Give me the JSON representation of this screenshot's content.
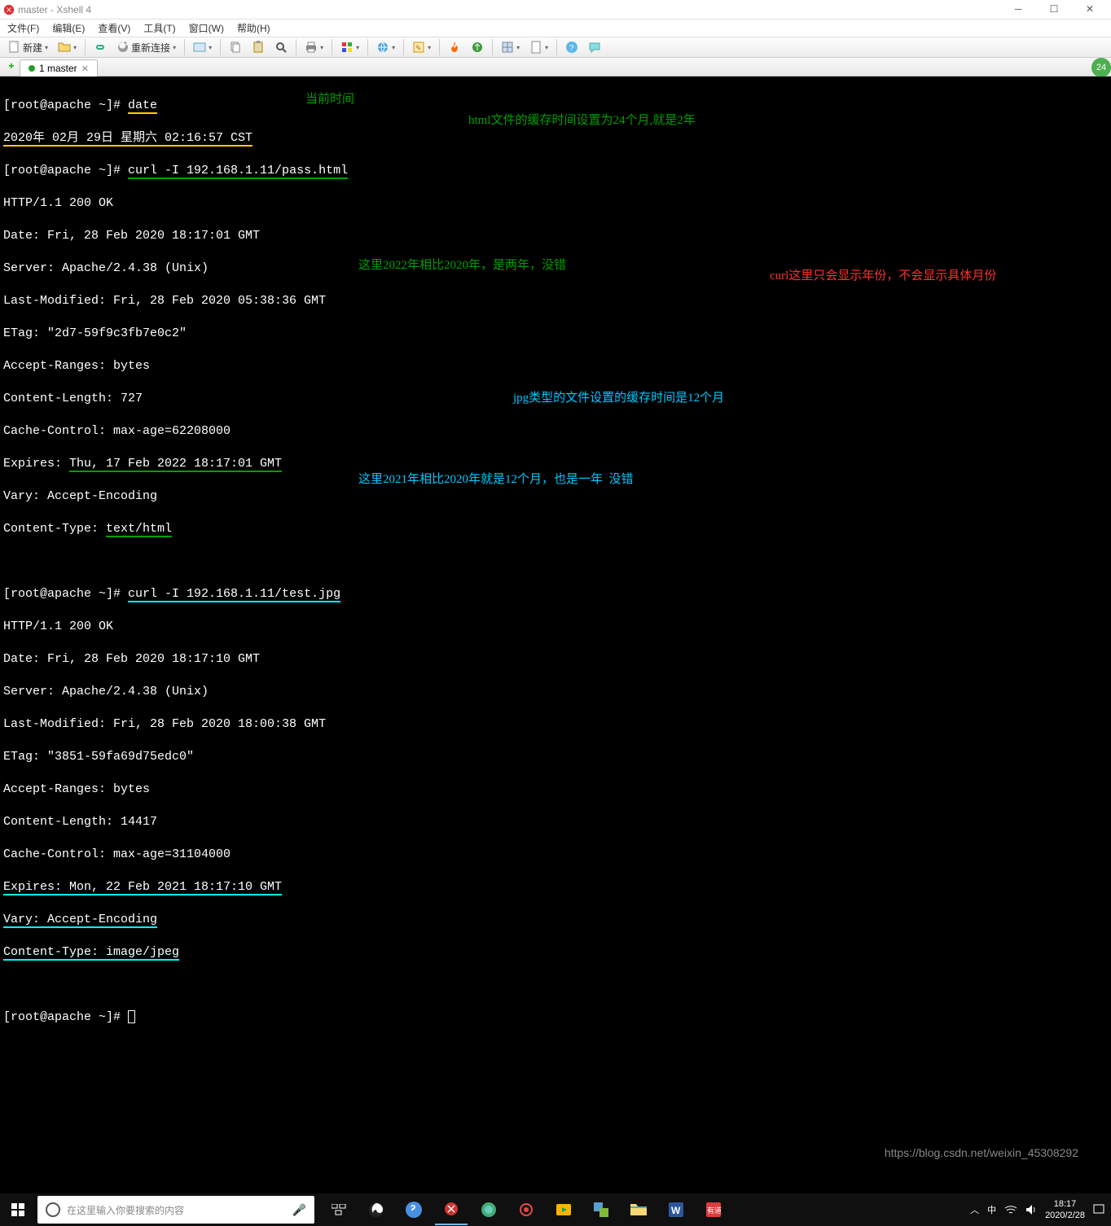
{
  "window": {
    "title": "master - Xshell 4"
  },
  "menus": {
    "file": "文件(F)",
    "edit": "编辑(E)",
    "view": "查看(V)",
    "tools": "工具(T)",
    "window": "窗口(W)",
    "help": "帮助(H)"
  },
  "toolbar": {
    "newBtn": "新建",
    "reconnect": " 重新连接"
  },
  "tab": {
    "label": "1 master",
    "badge": "24"
  },
  "term": {
    "prompt": "[root@apache ~]# ",
    "cmd1": "date",
    "dateOut": "2020年 02月 29日 星期六 02:16:57 CST",
    "cmd2": "curl -I 192.168.1.11/pass.html",
    "r1l1": "HTTP/1.1 200 OK",
    "r1l2": "Date: Fri, 28 Feb 2020 18:17:01 GMT",
    "r1l3": "Server: Apache/2.4.38 (Unix)",
    "r1l4": "Last-Modified: Fri, 28 Feb 2020 05:38:36 GMT",
    "r1l5": "ETag: \"2d7-59f9c3fb7e0c2\"",
    "r1l6": "Accept-Ranges: bytes",
    "r1l7": "Content-Length: 727",
    "r1l8": "Cache-Control: max-age=62208000",
    "r1l9a": "Expires: ",
    "r1l9b": "Thu, 17 Feb 2022 18:17:01 GMT",
    "r1l10": "Vary: Accept-Encoding",
    "r1l11a": "Content-Type: ",
    "r1l11b": "text/html",
    "cmd3": "curl -I 192.168.1.11/test.jpg",
    "r2l1": "HTTP/1.1 200 OK",
    "r2l2": "Date: Fri, 28 Feb 2020 18:17:10 GMT",
    "r2l3": "Server: Apache/2.4.38 (Unix)",
    "r2l4": "Last-Modified: Fri, 28 Feb 2020 18:00:38 GMT",
    "r2l5": "ETag: \"3851-59fa69d75edc0\"",
    "r2l6": "Accept-Ranges: bytes",
    "r2l7": "Content-Length: 14417",
    "r2l8": "Cache-Control: max-age=31104000",
    "r2l9": "Expires: Mon, 22 Feb 2021 18:17:10 GMT",
    "r2l10": "Vary: Accept-Encoding",
    "r2l11": "Content-Type: image/jpeg"
  },
  "ann": {
    "a1": "当前时间",
    "a2": "html文件的缓存时间设置为24个月,就是2年",
    "a3": "这里2022年相比2020年，是两年，没错",
    "a4": "curl这里只会显示年份，不会显示具体月份",
    "a5": "jpg类型的文件设置的缓存时间是12个月",
    "a6": "这里2021年相比2020年就是12个月，也是一年  没错"
  },
  "watermark": "https://blog.csdn.net/weixin_45308292",
  "taskbar": {
    "search": "在这里输入你要搜索的内容",
    "time": "18:17",
    "date": "2020/2/28"
  }
}
